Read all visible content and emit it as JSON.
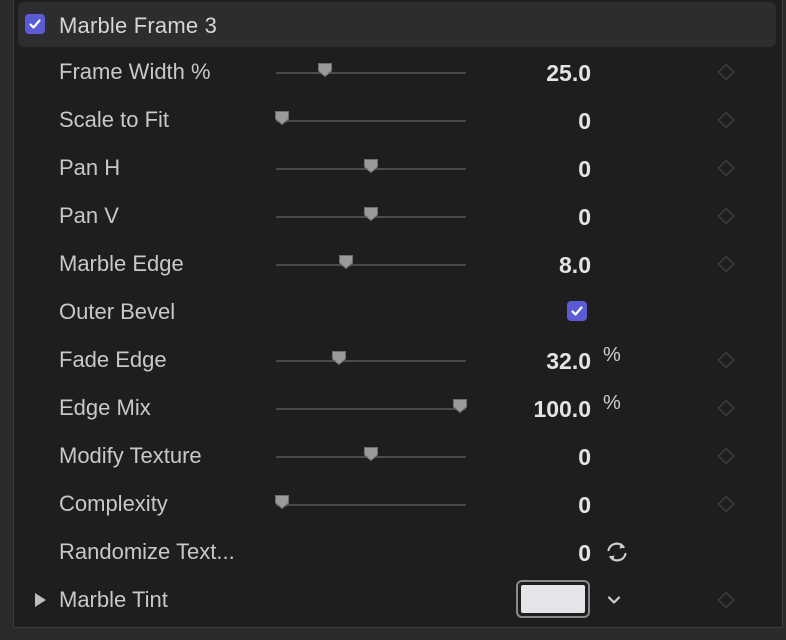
{
  "header": {
    "title": "Marble Frame 3",
    "enabled": true
  },
  "colors": {
    "accent": "#5b5bd6",
    "tint_swatch": "#e4e5e9"
  },
  "params": [
    {
      "label": "Frame Width %",
      "control": "slider",
      "value": "25.0",
      "unit": "",
      "level": 0.26
    },
    {
      "label": "Scale to Fit",
      "control": "slider",
      "value": "0",
      "unit": "",
      "level": 0.03
    },
    {
      "label": "Pan H",
      "control": "slider",
      "value": "0",
      "unit": "",
      "level": 0.5
    },
    {
      "label": "Pan V",
      "control": "slider",
      "value": "0",
      "unit": "",
      "level": 0.5
    },
    {
      "label": "Marble Edge",
      "control": "slider",
      "value": "8.0",
      "unit": "",
      "level": 0.37
    },
    {
      "label": "Outer Bevel",
      "control": "checkbox",
      "checked": true
    },
    {
      "label": "Fade Edge",
      "control": "slider",
      "value": "32.0",
      "unit": "%",
      "level": 0.33
    },
    {
      "label": "Edge Mix",
      "control": "slider",
      "value": "100.0",
      "unit": "%",
      "level": 0.97
    },
    {
      "label": "Modify Texture",
      "control": "slider",
      "value": "0",
      "unit": "",
      "level": 0.5
    },
    {
      "label": "Complexity",
      "control": "slider",
      "value": "0",
      "unit": "",
      "level": 0.03
    },
    {
      "label": "Randomize Text...",
      "control": "randomize",
      "value": "0"
    },
    {
      "label": "Marble Tint",
      "control": "color"
    }
  ],
  "icons": {
    "keyframe": "diamond-icon",
    "randomize": "refresh-icon",
    "disclosure": "triangle-right-icon",
    "dropdown": "chevron-down-icon",
    "check": "checkmark-icon"
  }
}
